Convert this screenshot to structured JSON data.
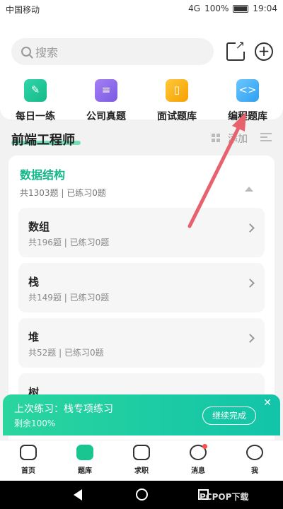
{
  "status": {
    "carrier": "中国移动",
    "battery": "100%",
    "time": "19:04",
    "signal": "4G"
  },
  "search": {
    "placeholder": "搜索"
  },
  "categories": [
    {
      "label": "每日一练",
      "color": "#1fc795",
      "icon": "pencil-icon"
    },
    {
      "label": "公司真题",
      "color": "#8a66ea",
      "icon": "document-icon"
    },
    {
      "label": "面试题库",
      "color": "#f7b216",
      "icon": "book-icon"
    },
    {
      "label": "编程题库",
      "color": "#3aa8f5",
      "icon": "code-icon"
    }
  ],
  "section": {
    "title": "前端工程师",
    "add": "添加"
  },
  "card": {
    "title": "数据结构",
    "meta": "共1303题 | 已练习0题",
    "items": [
      {
        "name": "数组",
        "meta": "共196题 | 已练习0题"
      },
      {
        "name": "栈",
        "meta": "共149题 | 已练习0题"
      },
      {
        "name": "堆",
        "meta": "共52题 | 已练习0题"
      },
      {
        "name": "树",
        "meta": ""
      }
    ]
  },
  "banner": {
    "title": "上次练习：栈专项练习",
    "sub": "剩余100%",
    "button": "继续完成"
  },
  "tabs": [
    {
      "label": "首页",
      "icon": "home-icon"
    },
    {
      "label": "题库",
      "icon": "question-bank-icon"
    },
    {
      "label": "求职",
      "icon": "job-icon"
    },
    {
      "label": "消息",
      "icon": "message-icon"
    },
    {
      "label": "我",
      "icon": "profile-icon"
    }
  ],
  "watermark": "PCPOP下载",
  "colors": {
    "accent": "#19c590",
    "annotation_arrow": "#e8626d"
  }
}
